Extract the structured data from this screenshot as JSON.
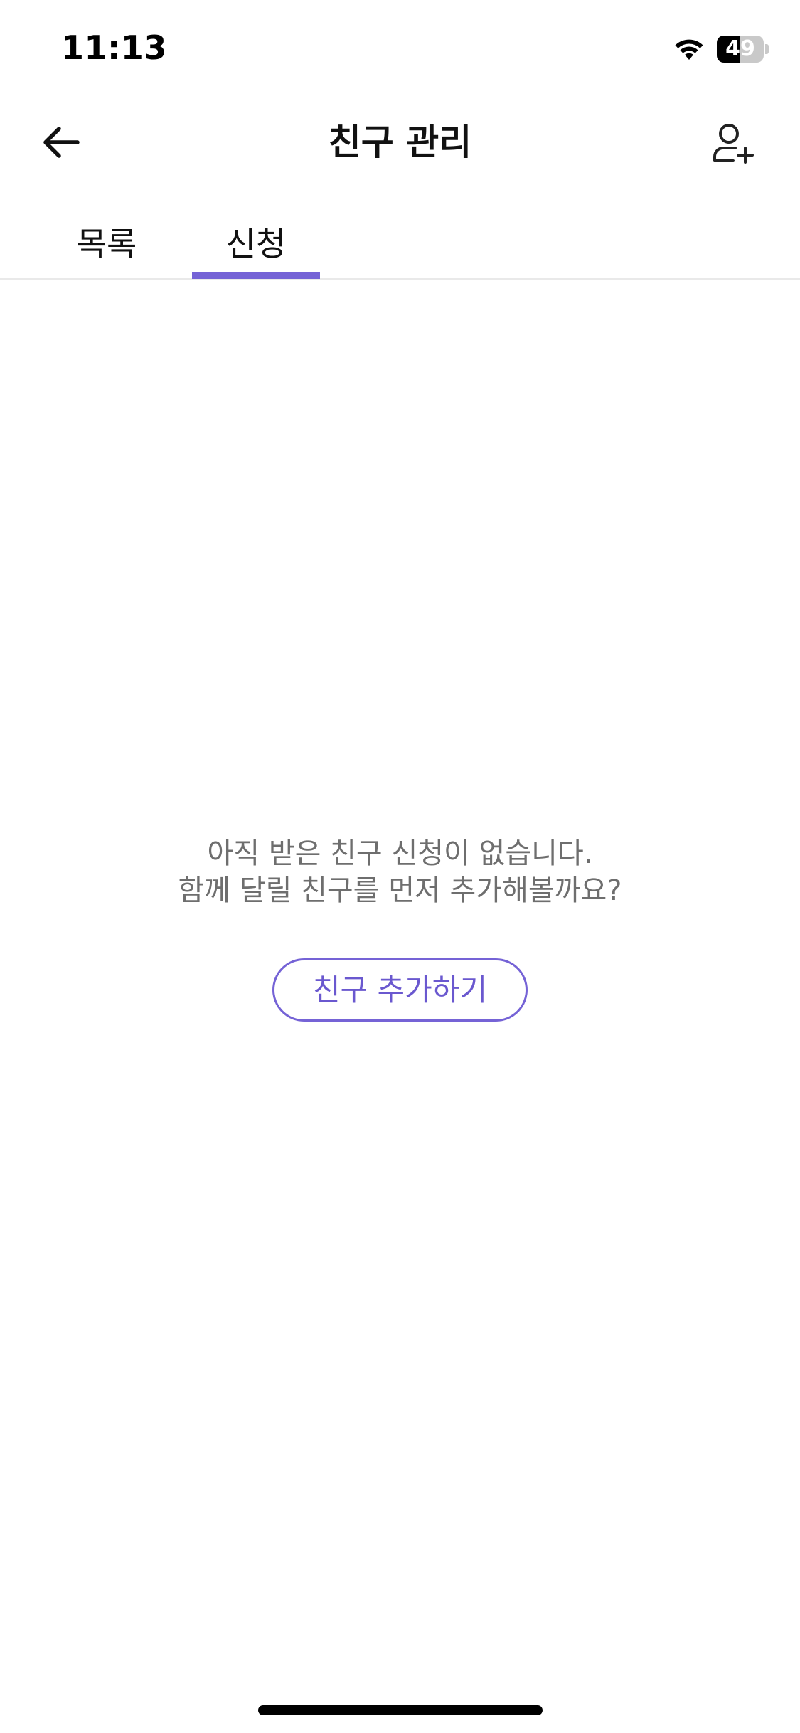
{
  "status_bar": {
    "time": "11:13",
    "battery_level": "49",
    "battery_fraction": 0.49,
    "icons": [
      "wifi-icon",
      "battery-icon"
    ]
  },
  "header": {
    "title": "친구 관리",
    "back_icon": "arrow-left-icon",
    "add_icon": "person-add-icon"
  },
  "tabs": [
    {
      "label": "목록",
      "active": false
    },
    {
      "label": "신청",
      "active": true
    }
  ],
  "empty_state": {
    "message": "아직 받은 친구 신청이 없습니다.",
    "submessage": "함께 달릴 친구를 먼저 추가해볼까요?",
    "button_label": "친구 추가하기"
  },
  "colors": {
    "accent": "#7563d6",
    "text_primary": "#111111",
    "text_secondary": "#6e6e6e",
    "divider": "#e9e9e9"
  }
}
